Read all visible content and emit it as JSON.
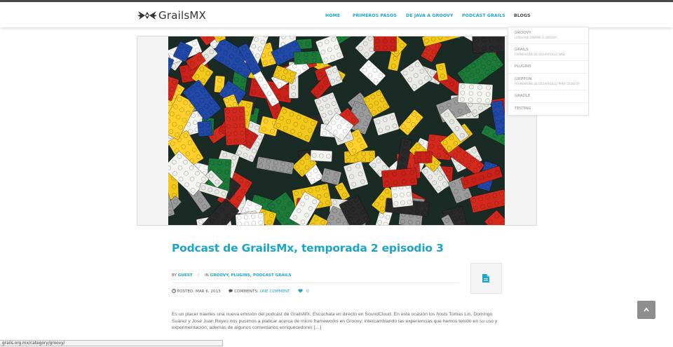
{
  "site": {
    "logo_text": "GrailsMX"
  },
  "nav": {
    "items": [
      {
        "label": "HOME"
      },
      {
        "label": "PRIMEROS PASOS"
      },
      {
        "label": "DE JAVA A GROOVY"
      },
      {
        "label": "PODCAST GRAILS"
      },
      {
        "label": "BLOGS"
      }
    ]
  },
  "dropdown": {
    "items": [
      {
        "title": "GROOVY",
        "sub": "LENGUAJE DINÁMICO GROOVY"
      },
      {
        "title": "GRAILS",
        "sub": "FRAMEWORK DE DESARROLLO WEB"
      },
      {
        "title": "PLUGINS",
        "sub": ""
      },
      {
        "title": "GRIFFON",
        "sub": "FRAMEWORK DE DESARROLLO PARA DESKTOP"
      },
      {
        "title": "GRADLE",
        "sub": ""
      },
      {
        "title": "TESTING",
        "sub": ""
      }
    ]
  },
  "post": {
    "title": "Podcast de GrailsMx, temporada 2 episodio 3",
    "by_label": "BY",
    "author": "GUEST",
    "in_label": "IN",
    "categories": "GROOVY, PLUGINS, PODCAST GRAILS",
    "posted_label": "POSTED: MAR 6, 2013",
    "comments_label": "COMMENTS:",
    "comments_link": "ONE COMMENT",
    "likes": "0",
    "excerpt": "Es un placer traerles una nueva emisión del podcast de GrailsMX. Escúchala en directo en SoundCloud. En esta ocasión los hosts Tomas Lin, Domingo Suárez y José Juan Reyes nos pusimos a platicar acerca de micro frameworks en Groovy; intercambiando las experiencias que hemos tenido en su uso y experimentación, además de algunos comentarios enriquecedores […]"
  },
  "status_url": "grails.org.mx/category/groovy/",
  "icons": {
    "logo": "winged-logo-icon",
    "clock": "clock-icon",
    "comment": "comment-icon",
    "heart": "heart-icon",
    "format": "document-icon",
    "scroll": "chevron-up-icon"
  },
  "colors": {
    "accent": "#1ba5c8",
    "text": "#666666"
  }
}
